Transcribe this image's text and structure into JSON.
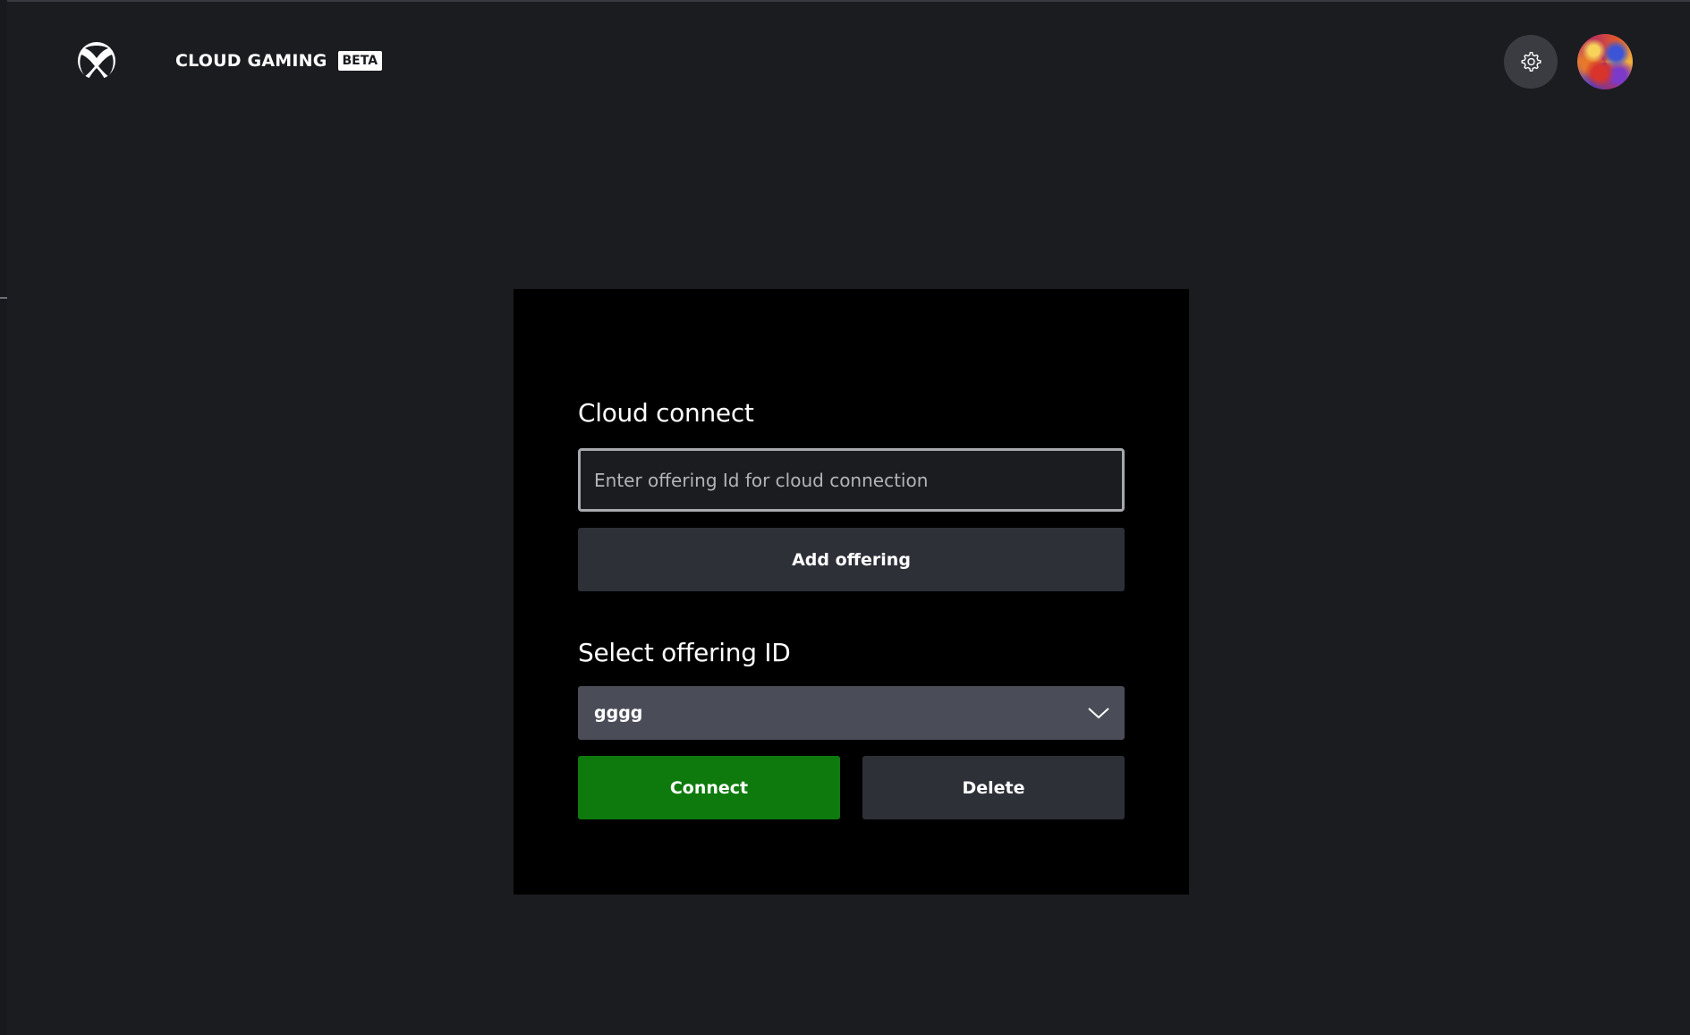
{
  "header": {
    "logo_icon": "xbox-logo-icon",
    "brand_title": "CLOUD GAMING",
    "beta_badge": "BETA",
    "settings_icon": "gear-icon"
  },
  "cloud_connect": {
    "title": "Cloud connect",
    "input_placeholder": "Enter offering Id for cloud connection",
    "input_value": "",
    "add_button_label": "Add offering"
  },
  "select_offering": {
    "title": "Select offering ID",
    "selected_value": "gggg",
    "dropdown_icon": "chevron-down-icon",
    "connect_button_label": "Connect",
    "delete_button_label": "Delete"
  },
  "colors": {
    "background": "#1b1c20",
    "card": "#000000",
    "secondary_button": "#2e3038",
    "select_background": "#4a4d57",
    "accent_green": "#0e7a0d"
  }
}
